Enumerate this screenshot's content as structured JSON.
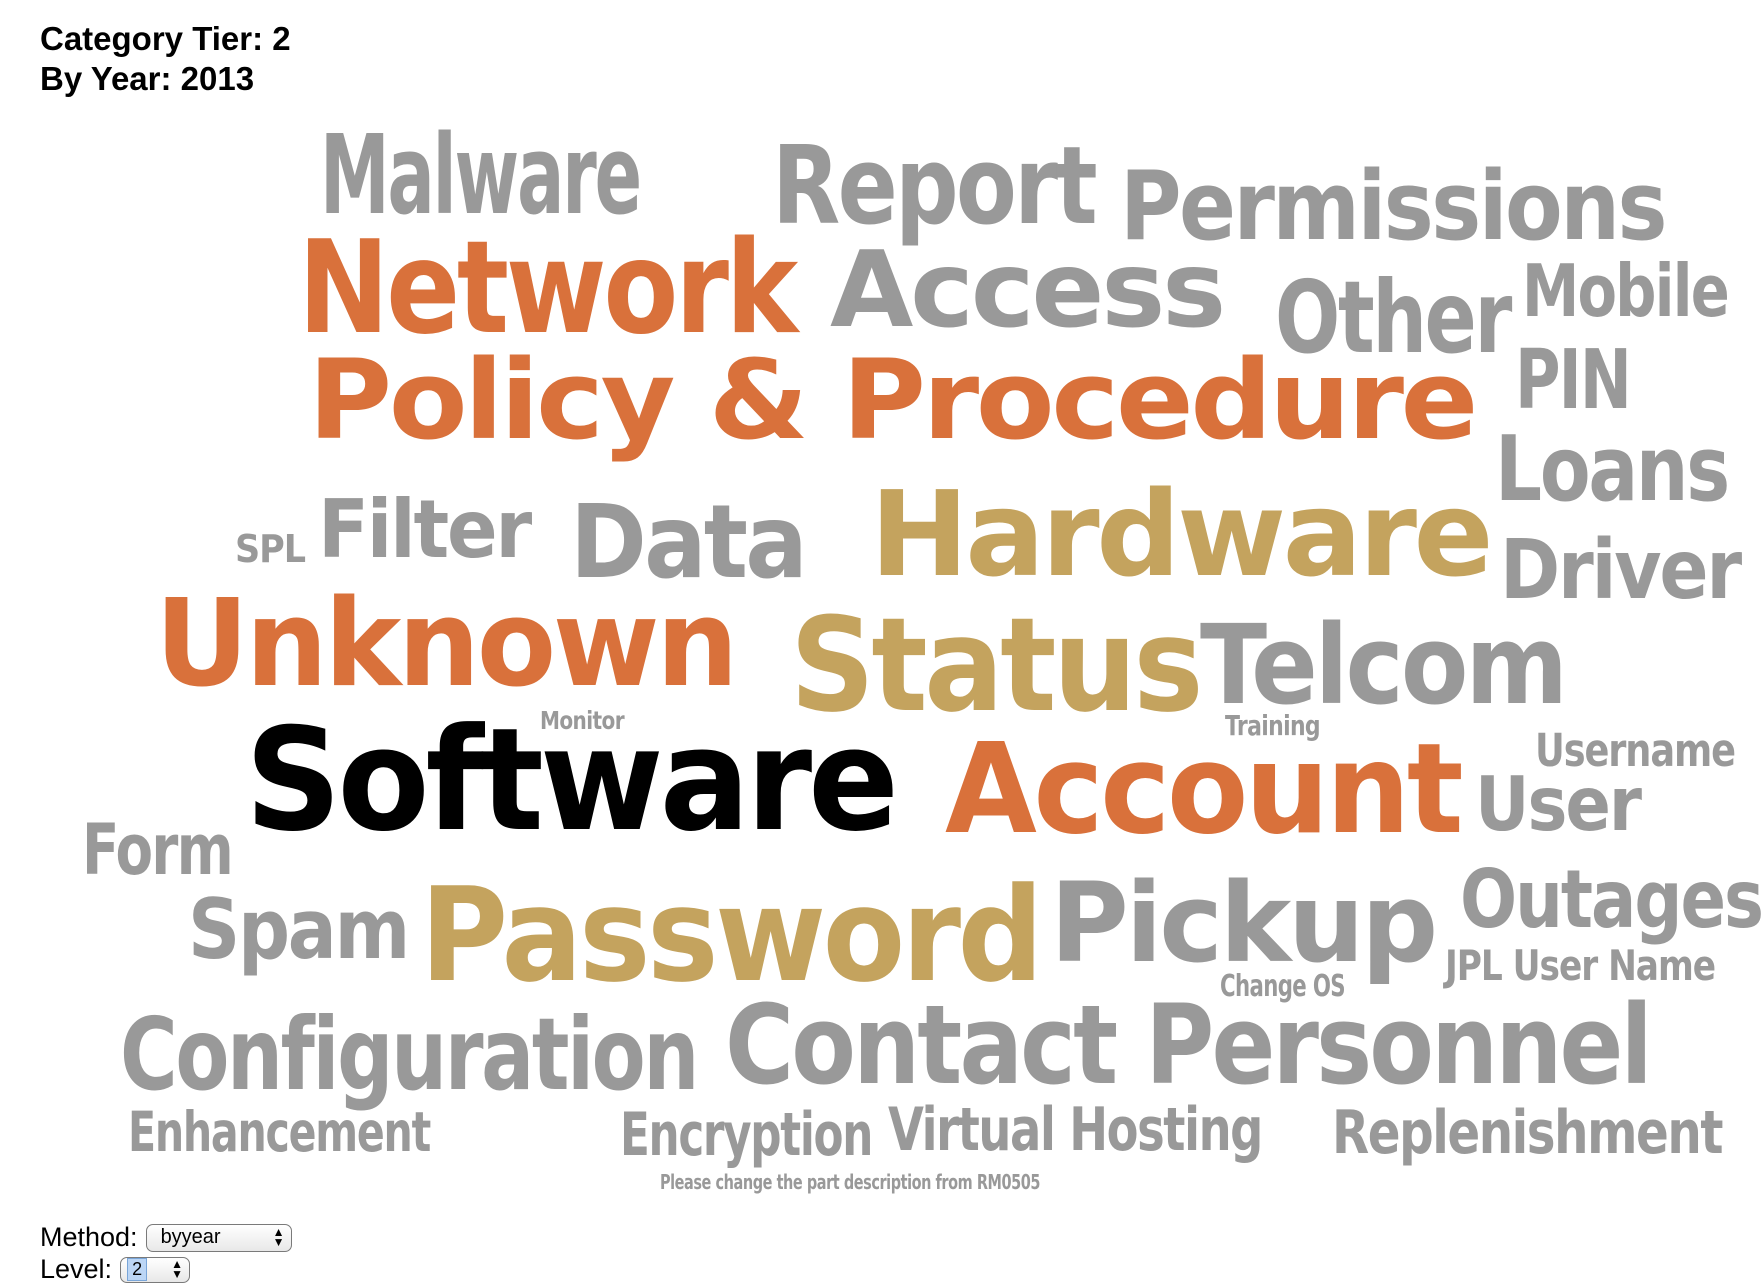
{
  "header": {
    "category_tier": "Category Tier: 2",
    "by_year": "By Year: 2013"
  },
  "colors": {
    "gray": "#999999",
    "orange": "#d9713b",
    "gold": "#c4a35e",
    "black": "#000000"
  },
  "word_cloud": {
    "words": [
      {
        "text": "Malware",
        "color": "gray"
      },
      {
        "text": "Report",
        "color": "gray"
      },
      {
        "text": "Permissions",
        "color": "gray"
      },
      {
        "text": "Network",
        "color": "orange"
      },
      {
        "text": "Access",
        "color": "gray"
      },
      {
        "text": "Other",
        "color": "gray"
      },
      {
        "text": "Mobile",
        "color": "gray"
      },
      {
        "text": "Policy & Procedure",
        "color": "orange"
      },
      {
        "text": "PIN",
        "color": "gray"
      },
      {
        "text": "Loans",
        "color": "gray"
      },
      {
        "text": "SPL",
        "color": "gray"
      },
      {
        "text": "Filter",
        "color": "gray"
      },
      {
        "text": "Data",
        "color": "gray"
      },
      {
        "text": "Hardware",
        "color": "gold"
      },
      {
        "text": "Driver",
        "color": "gray"
      },
      {
        "text": "Unknown",
        "color": "orange"
      },
      {
        "text": "Status",
        "color": "gold"
      },
      {
        "text": "Telcom",
        "color": "gray"
      },
      {
        "text": "Monitor",
        "color": "gray"
      },
      {
        "text": "Training",
        "color": "gray"
      },
      {
        "text": "Software",
        "color": "black"
      },
      {
        "text": "Account",
        "color": "orange"
      },
      {
        "text": "Username",
        "color": "gray"
      },
      {
        "text": "User",
        "color": "gray"
      },
      {
        "text": "Form",
        "color": "gray"
      },
      {
        "text": "Spam",
        "color": "gray"
      },
      {
        "text": "Password",
        "color": "gold"
      },
      {
        "text": "Pickup",
        "color": "gray"
      },
      {
        "text": "Outages",
        "color": "gray"
      },
      {
        "text": "JPL User Name",
        "color": "gray"
      },
      {
        "text": "Change OS",
        "color": "gray"
      },
      {
        "text": "Configuration",
        "color": "gray"
      },
      {
        "text": "Contact Personnel",
        "color": "gray"
      },
      {
        "text": "Enhancement",
        "color": "gray"
      },
      {
        "text": "Encryption",
        "color": "gray"
      },
      {
        "text": "Virtual Hosting",
        "color": "gray"
      },
      {
        "text": "Replenishment",
        "color": "gray"
      },
      {
        "text": "Please change the part description from RM0505",
        "color": "gray"
      }
    ]
  },
  "controls": {
    "method_label": "Method:",
    "method_value": "byyear",
    "level_label": "Level:",
    "level_value": "2"
  }
}
